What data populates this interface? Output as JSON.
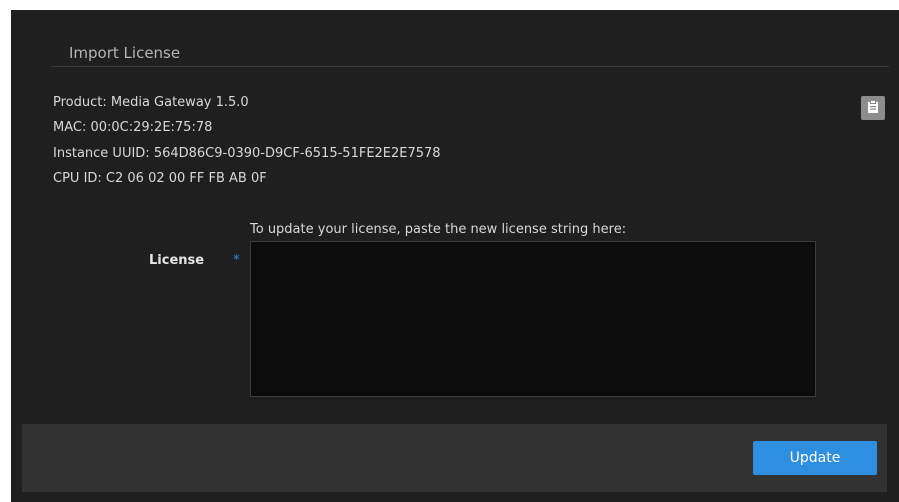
{
  "dialog": {
    "title": "Import License"
  },
  "info": {
    "product": "Product: Media Gateway 1.5.0",
    "mac": "MAC: 00:0C:29:2E:75:78",
    "instance_uuid": "Instance UUID: 564D86C9-0390-D9CF-6515-51FE2E2E7578",
    "cpu_id": "CPU ID: C2 06 02 00 FF FB AB 0F"
  },
  "form": {
    "hint": "To update your license, paste the new license string here:",
    "license_label": "License",
    "required_marker": "*",
    "license_value": ""
  },
  "footer": {
    "update_label": "Update"
  },
  "icons": {
    "clipboard": "clipboard-icon"
  },
  "colors": {
    "background": "#1f1f1f",
    "footer": "#323232",
    "accent": "#2e8fe0",
    "textarea": "#0c0c0c"
  }
}
